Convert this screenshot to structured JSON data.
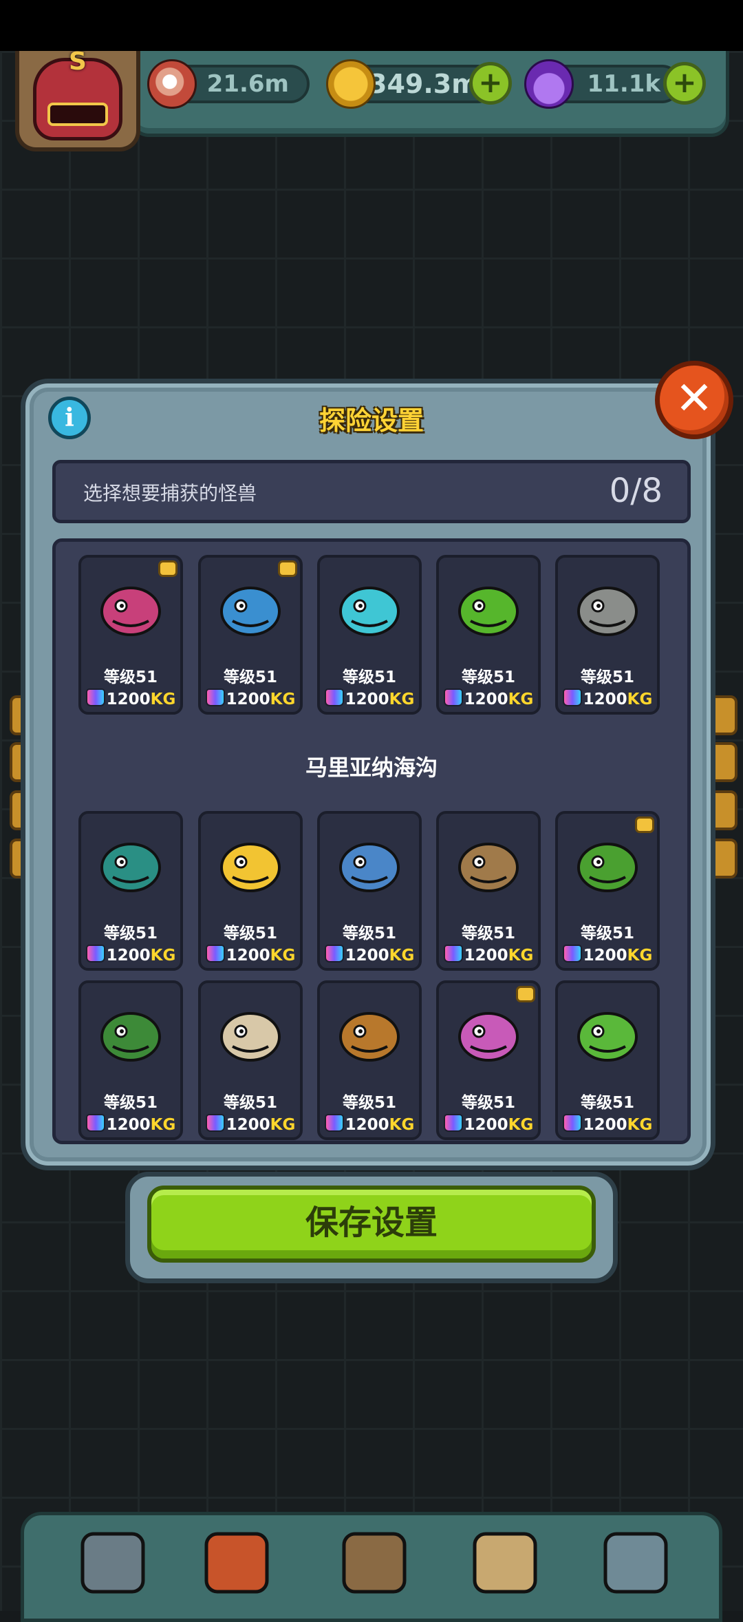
{
  "hud": {
    "eyeballs": "21.6m",
    "coins": "349.3m",
    "potions": "11.1k",
    "avatar_letter": "S",
    "icons": [
      "eyeball-icon",
      "coin-icon",
      "potion-icon",
      "plus-icon"
    ]
  },
  "dialog": {
    "title": "探险设置",
    "info_label": "i",
    "close_label": "✕",
    "select_prompt": "选择想要捕获的怪兽",
    "selected_count": "0/8",
    "region_name": "马里亚纳海沟",
    "save_label": "保存设置"
  },
  "monsters": [
    {
      "name": "purple-plant-monster",
      "level": "等级51",
      "weight": "1200",
      "unit": "KG",
      "badge": true,
      "color": "#c8407a"
    },
    {
      "name": "snail-house-monster",
      "level": "等级51",
      "weight": "1200",
      "unit": "KG",
      "badge": true,
      "color": "#3a8fd0"
    },
    {
      "name": "bubble-fish-monster",
      "level": "等级51",
      "weight": "1200",
      "unit": "KG",
      "badge": false,
      "color": "#3fc6d4"
    },
    {
      "name": "green-caterpillar-monster",
      "level": "等级51",
      "weight": "1200",
      "unit": "KG",
      "badge": false,
      "color": "#56b62c"
    },
    {
      "name": "rock-golem-monster",
      "level": "等级51",
      "weight": "1200",
      "unit": "KG",
      "badge": false,
      "color": "#8a8d8a"
    },
    {
      "name": "spiky-urchin-monster",
      "level": "等级51",
      "weight": "1200",
      "unit": "KG",
      "badge": false,
      "color": "#2a8f84"
    },
    {
      "name": "banana-squid-monster",
      "level": "等级51",
      "weight": "1200",
      "unit": "KG",
      "badge": false,
      "color": "#f2c432"
    },
    {
      "name": "blue-crab-monster",
      "level": "等级51",
      "weight": "1200",
      "unit": "KG",
      "badge": false,
      "color": "#4a86c8"
    },
    {
      "name": "walrus-shell-monster",
      "level": "等级51",
      "weight": "1200",
      "unit": "KG",
      "badge": false,
      "color": "#a07a4a"
    },
    {
      "name": "mantis-centipede-monster",
      "level": "等级51",
      "weight": "1200",
      "unit": "KG",
      "badge": true,
      "color": "#4aa030"
    },
    {
      "name": "green-worm-monster",
      "level": "等级51",
      "weight": "1200",
      "unit": "KG",
      "badge": false,
      "color": "#3d8a38"
    },
    {
      "name": "hermit-shell-monster",
      "level": "等级51",
      "weight": "1200",
      "unit": "KG",
      "badge": false,
      "color": "#d8c8a8"
    },
    {
      "name": "tiger-shrimp-monster",
      "level": "等级51",
      "weight": "1200",
      "unit": "KG",
      "badge": false,
      "color": "#b8782c"
    },
    {
      "name": "clam-octopus-monster",
      "level": "等级51",
      "weight": "1200",
      "unit": "KG",
      "badge": true,
      "color": "#c85ab8"
    },
    {
      "name": "seahorse-monster",
      "level": "等级51",
      "weight": "1200",
      "unit": "KG",
      "badge": false,
      "color": "#5ab83a"
    }
  ],
  "bottom_nav": [
    "shop-icon",
    "monster-fire-icon",
    "book-icon",
    "money-bag-icon",
    "grid-menu-icon"
  ]
}
